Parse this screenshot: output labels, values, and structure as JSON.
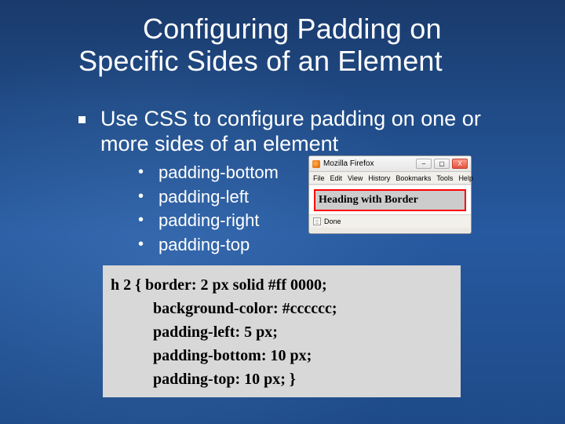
{
  "title": {
    "line1": "Configuring Padding on",
    "line2": "Specific Sides of an Element"
  },
  "bullet1": "Use CSS to configure padding on one or more sides of an element",
  "subitems": [
    "padding-bottom",
    "padding-left",
    "padding-right",
    "padding-top"
  ],
  "code": {
    "l1": "h 2 { border: 2 px solid #ff 0000;",
    "l2": "background-color: #cccccc;",
    "l3": "padding-left: 5 px;",
    "l4": "padding-bottom: 10 px;",
    "l5": "padding-top: 10 px; }"
  },
  "firefox": {
    "title": "Mozilla Firefox",
    "menu": {
      "file": "File",
      "edit": "Edit",
      "view": "View",
      "history": "History",
      "bookmarks": "Bookmarks",
      "tools": "Tools",
      "help": "Help"
    },
    "btn_min": "–",
    "btn_max": "▢",
    "btn_close": "X",
    "heading": "Heading with Border",
    "status": "Done"
  }
}
